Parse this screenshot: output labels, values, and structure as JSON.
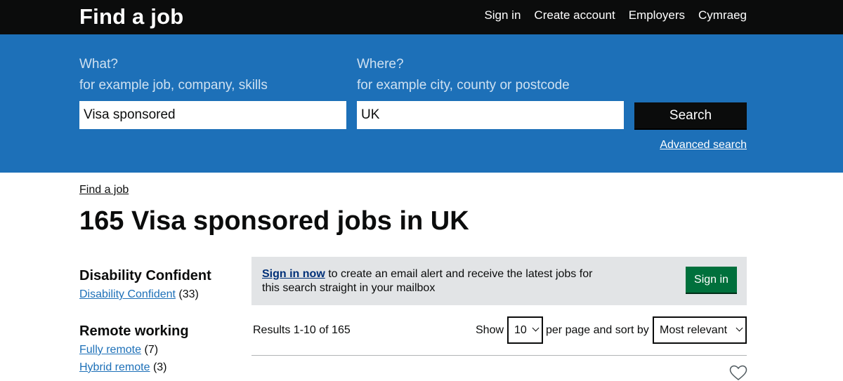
{
  "header": {
    "title": "Find a job",
    "nav": [
      "Sign in",
      "Create account",
      "Employers",
      "Cymraeg"
    ]
  },
  "search": {
    "what_label": "What?",
    "what_hint": "for example job, company, skills",
    "what_value": "Visa sponsored",
    "where_label": "Where?",
    "where_hint": "for example city, county or postcode",
    "where_value": "UK",
    "button_label": "Search",
    "advanced_link": "Advanced search"
  },
  "breadcrumb": "Find a job",
  "page_title": "165 Visa sponsored jobs in UK",
  "filters": [
    {
      "heading": "Disability Confident",
      "items": [
        {
          "label": "Disability Confident",
          "count": "(33)"
        }
      ]
    },
    {
      "heading": "Remote working",
      "items": [
        {
          "label": "Fully remote",
          "count": "(7)"
        },
        {
          "label": "Hybrid remote",
          "count": "(3)"
        }
      ]
    }
  ],
  "alert": {
    "link_text": "Sign in now",
    "text": " to create an email alert and receive the latest jobs for this search straight in your mailbox",
    "button_label": "Sign in"
  },
  "results": {
    "count_text": "Results 1-10 of 165",
    "show_label": "Show",
    "per_page_value": "10",
    "per_page_label": "per page and sort by",
    "sort_value": "Most relevant"
  },
  "icons": {
    "heart": "heart-outline-icon",
    "chevron": "chevron-down-icon"
  },
  "colors": {
    "header_bg": "#0b0c0c",
    "search_band": "#1d70b8",
    "link": "#1d70b8",
    "green_button": "#00703c",
    "alert_bg": "#e2e4e6"
  }
}
